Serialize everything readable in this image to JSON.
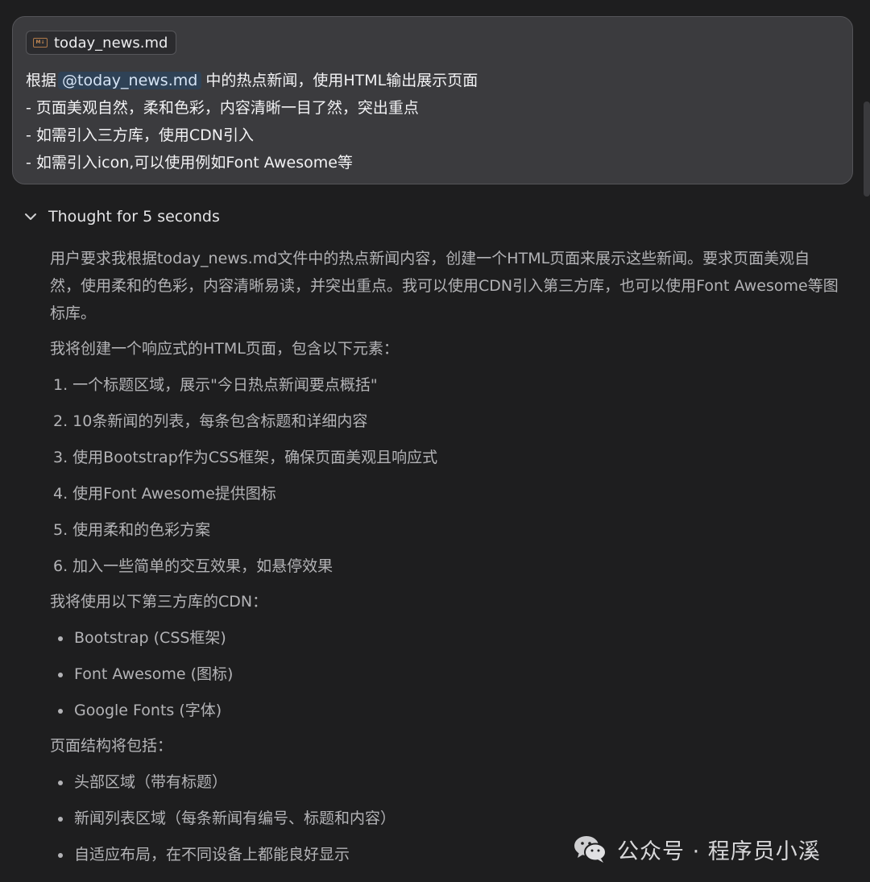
{
  "prompt": {
    "file_chip": {
      "icon": "markdown-file-icon",
      "label": "today_news.md"
    },
    "line1": {
      "before": "根据",
      "mention": "@today_news.md",
      "after": "中的热点新闻，使用HTML输出展示页面"
    },
    "line2": "- 页面美观自然，柔和色彩，内容清晰一目了然，突出重点",
    "line3": "- 如需引入三方库，使用CDN引入",
    "line4": "- 如需引入icon,可以使用例如Font Awesome等"
  },
  "thought": {
    "toggle_icon": "chevron-down-icon",
    "label": "Thought for 5 seconds",
    "intro": "用户要求我根据today_news.md文件中的热点新闻内容，创建一个HTML页面来展示这些新闻。要求页面美观自然，使用柔和的色彩，内容清晰易读，并突出重点。我可以使用CDN引入第三方库，也可以使用Font Awesome等图标库。",
    "plan_heading": "我将创建一个响应式的HTML页面，包含以下元素：",
    "plan_items": [
      "1. 一个标题区域，展示\"今日热点新闻要点概括\"",
      "2. 10条新闻的列表，每条包含标题和详细内容",
      "3. 使用Bootstrap作为CSS框架，确保页面美观且响应式",
      "4. 使用Font Awesome提供图标",
      "5. 使用柔和的色彩方案",
      "6. 加入一些简单的交互效果，如悬停效果"
    ],
    "cdn_heading": "我将使用以下第三方库的CDN：",
    "cdn_items": [
      "Bootstrap (CSS框架)",
      "Font Awesome (图标)",
      "Google Fonts (字体)"
    ],
    "structure_heading": "页面结构将包括：",
    "structure_items": [
      "头部区域（带有标题）",
      "新闻列表区域（每条新闻有编号、标题和内容）",
      "自适应布局，在不同设备上都能良好显示"
    ]
  },
  "watermark": {
    "icon": "wechat-icon",
    "text": "公众号 · 程序员小溪"
  },
  "colors": {
    "background": "#1e1e1f",
    "prompt_box": "#3b3b3e",
    "mention_bg": "#2f4256"
  }
}
